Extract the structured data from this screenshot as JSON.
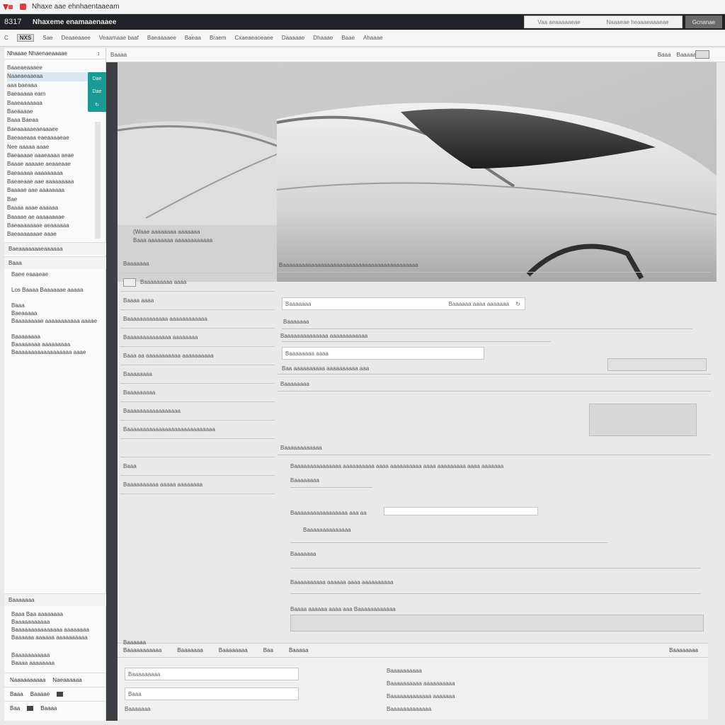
{
  "window": {
    "title": "Nhaxe aae ehnhaentaaeam"
  },
  "header": {
    "left": "8317",
    "title": "Nhaxeme enamaaenaaee",
    "search_text": [
      "Vaa aeaaaaaeae",
      "Naaaeae heaaaeaaaeae"
    ],
    "button": "Gcnanae"
  },
  "menu": {
    "badge": "NXS",
    "items": [
      "Sae",
      "Deaaeaaee",
      "Veaamaae baaf",
      "Baeaaaaee",
      "Baeaa",
      "Braem",
      "Cxaeaeaoeaee",
      "Daaaaae",
      "Dhaaae",
      "Baae",
      "Ahaaae"
    ]
  },
  "sidebar": {
    "head_label": "Nhaaae Nhaenaeaaaae",
    "head_right": "↕",
    "tree": [
      "Baaeaeaaaee",
      "Naaeaeaaeaa",
      "aaa baeaaa",
      "Baeaaaaa eam",
      "Baaeaaaaaaa",
      "Baeaaaae",
      "Baaa Baeaa",
      "Baeaaaaaeaeaaaee",
      "Baeaaeaaa eaeaaaaeae",
      "Nee aaaaa aaae",
      "Baeaaaae aaaeaaaa aeae",
      "Baaae aaaaae aeaaeaae",
      "Baeaaaaa aaaaaaaaa",
      "Baeaeaae aae aaaaaaaaa",
      "Baaaae aae aaaaaaaa",
      "Bae",
      "Baaaa aaae aaaaaa",
      "Baaaae ae aaaaaaaae",
      "Baeaaaaaaae aeaaaaaa",
      "Baeaaaaaaae aaae",
      "Baaaaaaae"
    ],
    "teal_tab": [
      "Dae",
      "Dae",
      "↻"
    ],
    "section1": "Baeaaaaaaaeaaaaaa",
    "section2": "Baaa",
    "list2": [
      "Baee eaaaeae",
      "",
      "Los Baaaa Baaaaaae aaaaa",
      "",
      "Baaa",
      "Baeaaaaa",
      "Baaaaaaaae aaaaaaaaaaa aaaae",
      "",
      "Baaaaaaaa",
      "Baaaaaaaa aaaaaaaaa",
      "Baaaaaaaaaaaaaaaaaa aaae"
    ],
    "section3": "Baaaaaaa",
    "list3": [
      "Baaa Baa aaaaaaaa",
      "Baaaaaaaaaaa",
      "Baaaaaaaaaaaaaaa aaaaaaaa",
      "Baaaaaa aaaaaa aaaaaaaaaa"
    ],
    "list4": [
      "Baaaaaaaaaaa",
      "Baaaa aaaaaaaa"
    ],
    "footer_row1": [
      "Naaaaaaaaaa",
      "Naeaaaaaa"
    ],
    "footer_row2": [
      "Baaa",
      "Baaaae"
    ],
    "footer_row3": [
      "Baa",
      "Baaaa"
    ]
  },
  "content": {
    "crumb": "Baaaa",
    "top_right": [
      "Baaa",
      "Baaaaaaa"
    ],
    "hero_caption1": "(Waae aaaaaaaa aaaaaaa",
    "hero_caption2": "Baaa aaaaaaaa aaaaaaaaaaaa",
    "left_rows": [
      "Baaaaaaa",
      "Baaaaaaaaa aaaa",
      "Baaaa aaaa",
      "Baaaaaaaaaaaaa aaaaaaaaaaaa",
      "Baaaaaaaaaaaaaa aaaaaaaa",
      "Baaa aa aaaaaaaaaaa aaaaaaaaaa",
      "Baaaaaaaa",
      "Baaaaaaaaa",
      "Baaaaaaaaaaaaaaaaa",
      "Baaaaaaaaaaaaaaaaaaaaaaaaaaaa",
      "",
      "Baaa",
      "Baaaaaaaaaa aaaaa  aaaaaaaa"
    ],
    "right": {
      "heading": "Baaaaaaaaaaaaaaaaaaaaaaaaaaaaaaaaaaaaaaaaaaa",
      "field1": "Baaaaaaa",
      "field1_right": "Baaaaaa aaaa aaaaaaa",
      "label2": "Baaaaaaa",
      "label3": "Baaaaaaaaaaaaaa aaaaaaaaaaaa",
      "field2": "Baaaaaaaa aaaa",
      "label4": "Baa aaaaaaaaaa aaaaaaaaaa aaa",
      "label5": "Baaaaaaaa",
      "label6": "Baaaaaaaaaaaa",
      "sub_heading": "Baaaaaaaaaaaaaaa aaaaaaaaaa aaaa aaaaaaaaaa aaaa aaaaaaaaa aaaa aaaaaaa",
      "sub_label1": "Baaaaaaaa",
      "sub_label2": "Baaaaaaaaaaaaaaaaa aaa aa",
      "sub_label3": "Baaaaaaaaaaaaaa",
      "sub_label4": "Baaaaaaa",
      "sub_label5": "Baaaaaaaaaa aaaaaa aaaa aaaaaaaaaa",
      "sub_label6": "Baaaaaaa aaaaaa aaaa aaaaa",
      "footer_label": "Baaaa aaaaaa aaaa aaa Baaaaaaaaaaaa"
    }
  },
  "bottom": {
    "title": "Baaaaaa",
    "tabs": [
      "Baaaaaaaaaaa",
      "Baaaaaaa",
      "Baaaaaaaa",
      "Baa",
      "Baaaaa"
    ],
    "tab_right": "Baaaaaaaa",
    "left_lines": [
      "Baaaaaaaaa",
      "Baaa",
      "Baaaaaaa"
    ],
    "right_lines": [
      "Baaaaaaaaaa",
      "Baaaaaaaaaa aaaaaaaaaa",
      "Baaaaaaaaaaaaa aaaaaaa",
      "Baaaaaaaaaaaaa"
    ]
  }
}
